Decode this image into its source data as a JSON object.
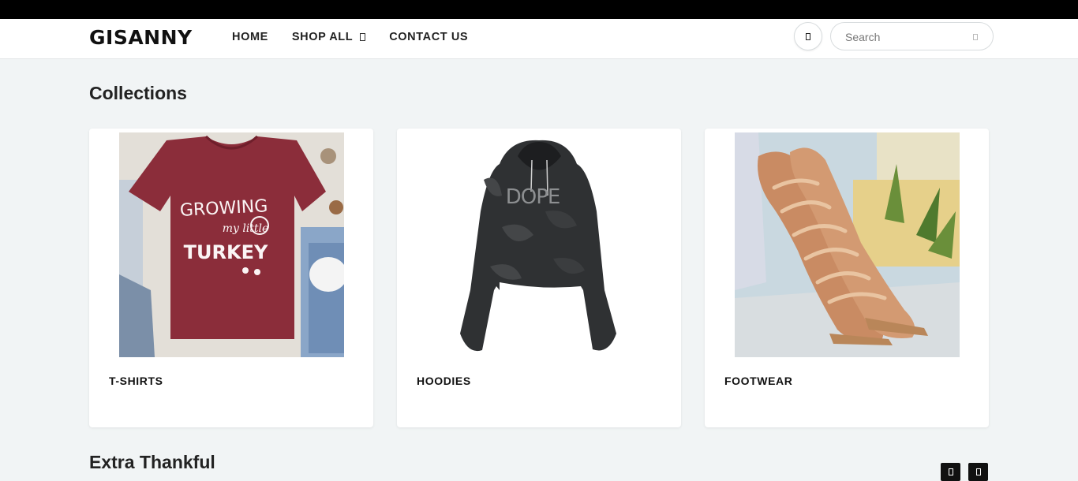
{
  "header": {
    "logo": "GISANNY",
    "nav": [
      {
        "label": "HOME"
      },
      {
        "label": "SHOP ALL"
      },
      {
        "label": "CONTACT US"
      }
    ],
    "search": {
      "placeholder": "Search"
    }
  },
  "collections": {
    "title": "Collections",
    "items": [
      {
        "label": "T-SHIRTS"
      },
      {
        "label": "HOODIES"
      },
      {
        "label": "FOOTWEAR"
      }
    ]
  },
  "featured": {
    "title": "Extra Thankful"
  },
  "colors": {
    "topbar": "#000000",
    "page_bg": "#f1f4f5",
    "tshirt": "#8b2d3a",
    "hoodie": "#2f3133"
  },
  "icons": [
    "cart-icon",
    "search-icon",
    "chevron-down-icon",
    "arrow-left-icon",
    "arrow-right-icon"
  ]
}
